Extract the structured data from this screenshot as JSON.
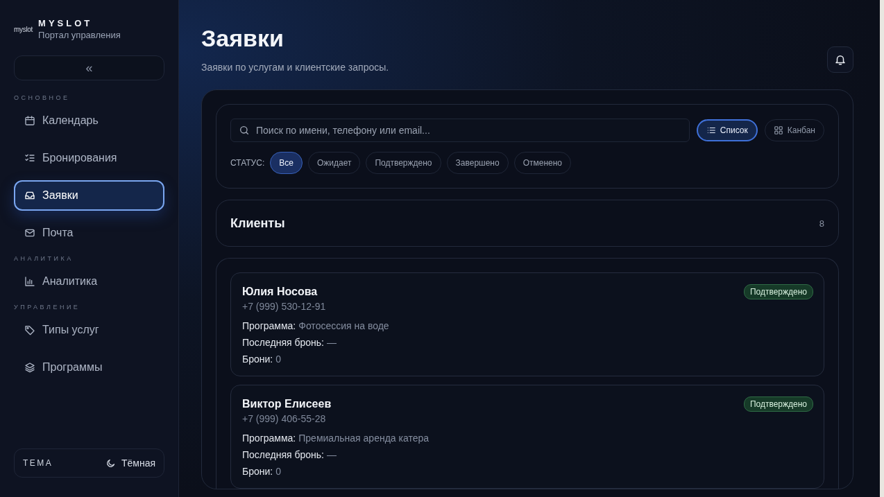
{
  "brand": {
    "logo": "myslot",
    "name": "MYSLOT",
    "subtitle": "Портал управления"
  },
  "collapse_button": {
    "label": "«"
  },
  "sidebar": {
    "sections": [
      {
        "title": "ОСНОВНОЕ",
        "items": [
          {
            "label": "Календарь",
            "selected": false
          },
          {
            "label": "Бронирования",
            "selected": false
          },
          {
            "label": "Заявки",
            "selected": true
          },
          {
            "label": "Почта",
            "selected": false
          }
        ]
      },
      {
        "title": "АНАЛИТИКА",
        "items": [
          {
            "label": "Аналитика",
            "selected": false
          }
        ]
      },
      {
        "title": "УПРАВЛЕНИЕ",
        "items": [
          {
            "label": "Типы услуг",
            "selected": false
          },
          {
            "label": "Программы",
            "selected": false
          }
        ]
      }
    ]
  },
  "theme": {
    "label": "ТЕМА",
    "value": "Тёмная"
  },
  "page": {
    "title": "Заявки",
    "subtitle": "Заявки по услугам и клиентские запросы."
  },
  "search": {
    "placeholder": "Поиск по имени, телефону или email..."
  },
  "view_toggle": [
    {
      "label": "Список",
      "selected": true
    },
    {
      "label": "Канбан",
      "selected": false
    }
  ],
  "status_filter": {
    "label": "СТАТУС:",
    "options": [
      {
        "label": "Все",
        "selected": true
      },
      {
        "label": "Ожидает",
        "selected": false
      },
      {
        "label": "Подтверждено",
        "selected": false
      },
      {
        "label": "Завершено",
        "selected": false
      },
      {
        "label": "Отменено",
        "selected": false
      }
    ]
  },
  "clients_header": {
    "title": "Клиенты",
    "count": "8"
  },
  "clients": [
    {
      "name": "Юлия Носова",
      "phone": "+7 (999) 530-12-91",
      "status": {
        "label": "Подтверждено",
        "kind": "confirmed"
      },
      "fields": [
        {
          "label": "Программа:",
          "value": "Фотосессия на воде"
        },
        {
          "label": "Последняя бронь:",
          "value": "—"
        },
        {
          "label": "Брони:",
          "value": "0"
        }
      ]
    },
    {
      "name": "Виктор Елисеев",
      "phone": "+7 (999) 406-55-28",
      "status": {
        "label": "Подтверждено",
        "kind": "confirmed"
      },
      "fields": [
        {
          "label": "Программа:",
          "value": "Премиальная аренда катера"
        },
        {
          "label": "Последняя бронь:",
          "value": "—"
        },
        {
          "label": "Брони:",
          "value": "0"
        }
      ]
    }
  ]
}
